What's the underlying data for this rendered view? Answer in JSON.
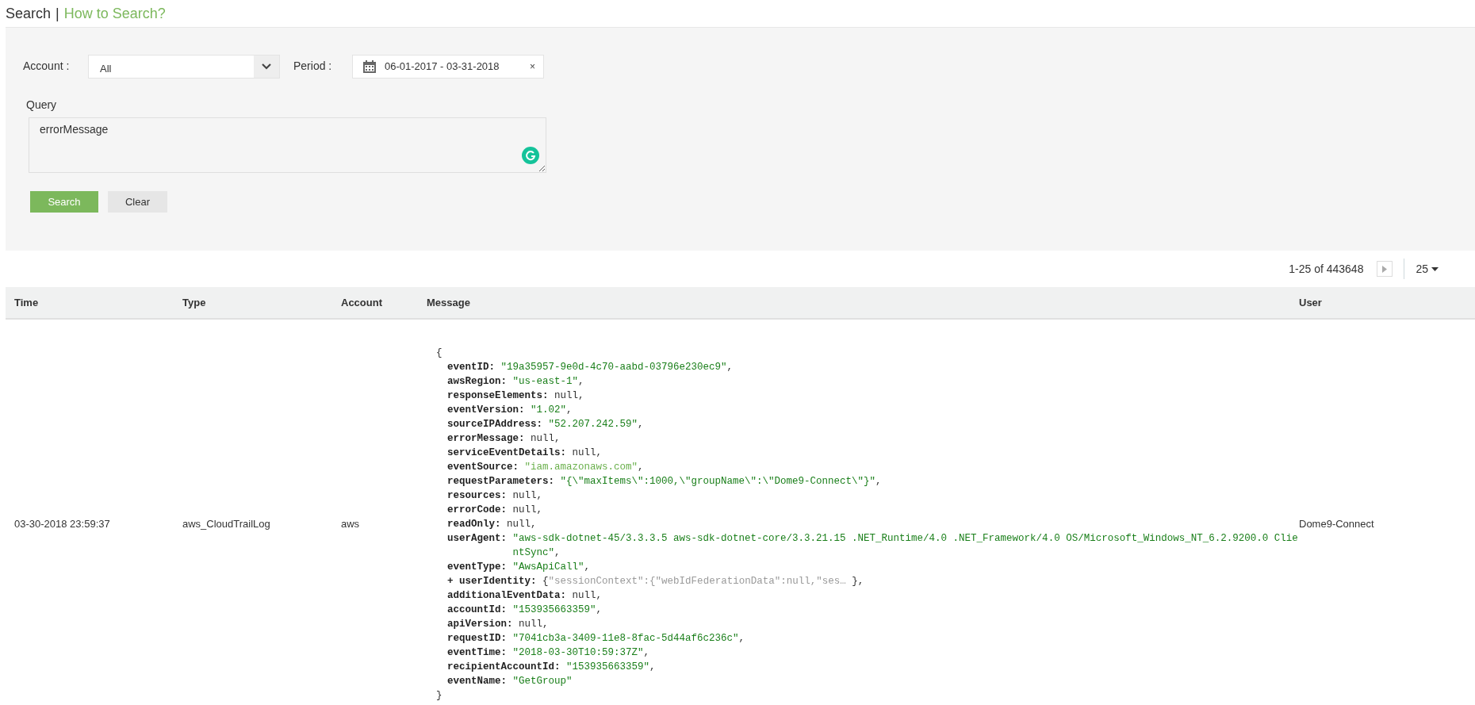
{
  "header": {
    "title": "Search",
    "separator": "|",
    "link": "How to Search?"
  },
  "filters": {
    "account": {
      "label": "Account :",
      "value": "All"
    },
    "period": {
      "label": "Period :",
      "value": "06-01-2017 - 03-31-2018",
      "clear": "×"
    },
    "query": {
      "label": "Query",
      "value": "errorMessage"
    },
    "buttons": [
      {
        "label": "Search",
        "kind": "primary"
      },
      {
        "label": "Clear",
        "kind": "secondary"
      }
    ]
  },
  "pagination": {
    "range": "1-25 of 443648",
    "page_size": "25"
  },
  "table": {
    "columns": [
      "Time",
      "Type",
      "Account",
      "Message",
      "User"
    ],
    "rows": [
      {
        "time": "03-30-2018 23:59:37",
        "type": "aws_CloudTrailLog",
        "account": "aws",
        "user": "Dome9-Connect",
        "message": {
          "open": "{",
          "close": "}",
          "lines": [
            {
              "kind": "string",
              "key": "eventID:",
              "value": "\"19a35957-9e0d-4c70-aabd-03796e230ec9\"",
              "punct": ","
            },
            {
              "kind": "string",
              "key": "awsRegion:",
              "value": "\"us-east-1\"",
              "punct": ","
            },
            {
              "kind": "null",
              "key": "responseElements:",
              "value": "null",
              "punct": ","
            },
            {
              "kind": "string",
              "key": "eventVersion:",
              "value": "\"1.02\"",
              "punct": ","
            },
            {
              "kind": "string",
              "key": "sourceIPAddress:",
              "value": "\"52.207.242.59\"",
              "punct": ","
            },
            {
              "kind": "null",
              "key": "errorMessage:",
              "value": "null",
              "punct": ","
            },
            {
              "kind": "null",
              "key": "serviceEventDetails:",
              "value": "null",
              "punct": ","
            },
            {
              "kind": "host",
              "key": "eventSource:",
              "value": "\"iam.amazonaws.com\"",
              "punct": ","
            },
            {
              "kind": "string",
              "key": "requestParameters:",
              "value": "\"{\\\"maxItems\\\":1000,\\\"groupName\\\":\\\"Dome9-Connect\\\"}\"",
              "punct": ","
            },
            {
              "kind": "null",
              "key": "resources:",
              "value": "null",
              "punct": ","
            },
            {
              "kind": "null",
              "key": "errorCode:",
              "value": "null",
              "punct": ","
            },
            {
              "kind": "null",
              "key": "readOnly:",
              "value": "null",
              "punct": ","
            },
            {
              "kind": "string",
              "key": "userAgent:",
              "value": "\"aws-sdk-dotnet-45/3.3.3.5 aws-sdk-dotnet-core/3.3.21.15 .NET_Runtime/4.0 .NET_Framework/4.0 OS/Microsoft_Windows_NT_6.2.9200.0 ClientSync\"",
              "punct": ","
            },
            {
              "kind": "string",
              "key": "eventType:",
              "value": "\"AwsApiCall\"",
              "punct": ","
            },
            {
              "kind": "collapsed",
              "toggle": "+",
              "key": "userIdentity:",
              "open": "{",
              "value": "\"sessionContext\":{\"webIdFederationData\":null,\"ses…",
              "close": "}",
              "punct": ","
            },
            {
              "kind": "null",
              "key": "additionalEventData:",
              "value": "null",
              "punct": ","
            },
            {
              "kind": "string",
              "key": "accountId:",
              "value": "\"153935663359\"",
              "punct": ","
            },
            {
              "kind": "null",
              "key": "apiVersion:",
              "value": "null",
              "punct": ","
            },
            {
              "kind": "string",
              "key": "requestID:",
              "value": "\"7041cb3a-3409-11e8-8fac-5d44af6c236c\"",
              "punct": ","
            },
            {
              "kind": "string",
              "key": "eventTime:",
              "value": "\"2018-03-30T10:59:37Z\"",
              "punct": ","
            },
            {
              "kind": "string",
              "key": "recipientAccountId:",
              "value": "\"153935663359\"",
              "punct": ","
            },
            {
              "kind": "string",
              "key": "eventName:",
              "value": "\"GetGroup\""
            }
          ]
        }
      }
    ]
  }
}
